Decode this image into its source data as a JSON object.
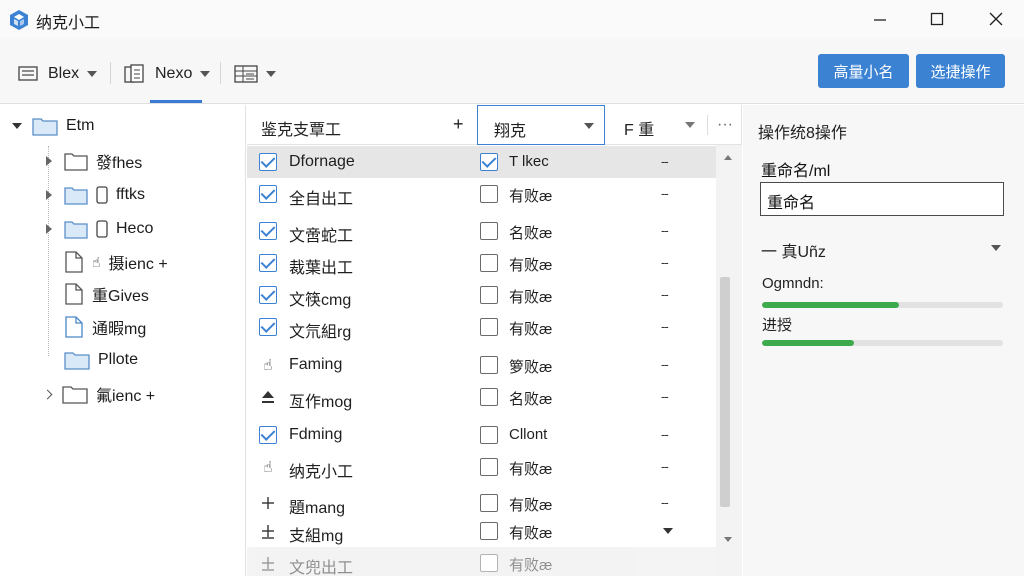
{
  "window": {
    "title": "纳克小工"
  },
  "toolbar": {
    "items": [
      {
        "label": "Blex"
      },
      {
        "label": "Nexo"
      },
      {
        "label": ""
      }
    ],
    "primary_button": "高量小名",
    "secondary_button": "选捷操作"
  },
  "tree": {
    "root": "Etm",
    "items": [
      {
        "label": "發fhes"
      },
      {
        "label": "fftks"
      },
      {
        "label": "Heco"
      },
      {
        "label": "摄ienc +"
      },
      {
        "label": "重Gives"
      },
      {
        "label": "通暇mg"
      },
      {
        "label": "Pllote"
      }
    ],
    "last": "氟ienc +"
  },
  "list": {
    "header": {
      "col1": "鉴克支覃工",
      "add": "+",
      "filter": "翔克",
      "col3": "F 重",
      "more": "···"
    },
    "rows": [
      {
        "name": "Dfornage",
        "val": "T lkec",
        "c1": "checked",
        "c2": true,
        "sel": true
      },
      {
        "name": "全自出工",
        "val": "有败æ",
        "c1": "checked",
        "c2": false
      },
      {
        "name": "文啻蛇工",
        "val": "名败æ",
        "c1": "checked",
        "c2": false
      },
      {
        "name": "裁葉出工",
        "val": "有败æ",
        "c1": "checked",
        "c2": false
      },
      {
        "name": "文筷cmg",
        "val": "有败æ",
        "c1": "checked",
        "c2": false
      },
      {
        "name": "文氘組rg",
        "val": "有败æ",
        "c1": "checked",
        "c2": false
      },
      {
        "name": "Faming",
        "val": "箩败æ",
        "c1": "touch",
        "c2": false
      },
      {
        "name": "亙作mog",
        "val": "名败æ",
        "c1": "upload",
        "c2": false
      },
      {
        "name": "Fdming",
        "val": "Cllont",
        "c1": "checked",
        "c2": false
      },
      {
        "name": "纳克小工",
        "val": "有败æ",
        "c1": "touch",
        "c2": false
      },
      {
        "name": "題mang",
        "val": "有败æ",
        "c1": "plus",
        "c2": false
      },
      {
        "name": "支組mg",
        "val": "有败æ",
        "c1": "plus2",
        "c2": false
      },
      {
        "name": "文兜出工",
        "val": "有败æ",
        "c1": "plus2",
        "c2": false,
        "ghost": true
      }
    ],
    "dots": "--"
  },
  "props": {
    "header": "操作统8操作",
    "rename_label": "重命名/ml",
    "rename_value": "重命名",
    "section": "一 真Uñz",
    "progress": [
      {
        "label": "Ogmndn:",
        "value": 0.57
      },
      {
        "label": "进授",
        "value": 0.38
      }
    ]
  },
  "colors": {
    "accent": "#3b82d3",
    "progress": "#3daa4e"
  }
}
